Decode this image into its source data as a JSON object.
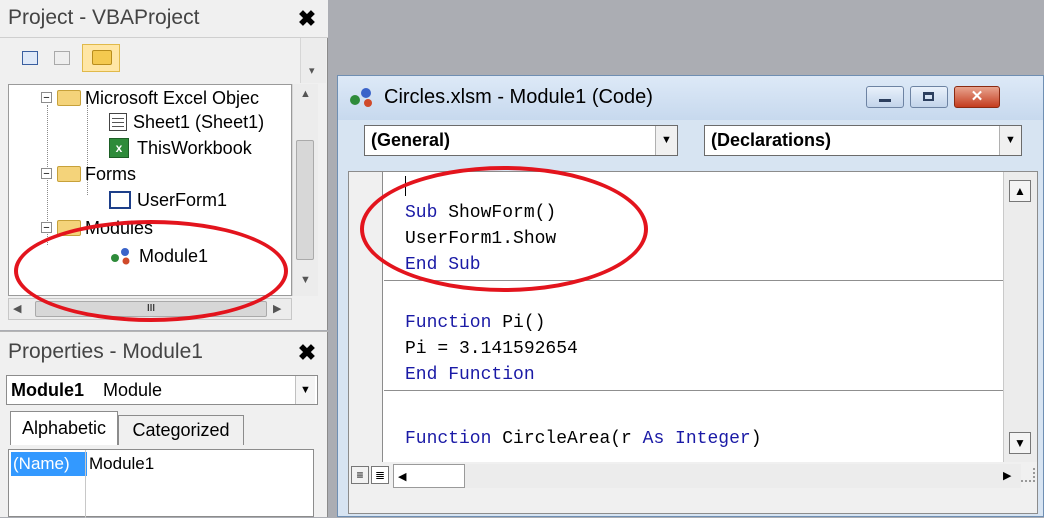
{
  "project_panel": {
    "title": "Project - VBAProject",
    "close_glyph": "✖",
    "toolbar": {
      "view_code_icon": "view-code-icon",
      "view_object_icon": "view-object-icon",
      "toggle_folders_icon": "toggle-folders-icon"
    },
    "tree": [
      {
        "label": "Microsoft Excel Objec",
        "expander": "−",
        "icon": "folder-icon"
      },
      {
        "label": "Sheet1 (Sheet1)",
        "icon": "worksheet-icon"
      },
      {
        "label": "ThisWorkbook",
        "icon": "workbook-icon"
      },
      {
        "label": "Forms",
        "expander": "−",
        "icon": "folder-icon"
      },
      {
        "label": "UserForm1",
        "icon": "userform-icon"
      },
      {
        "label": "Modules",
        "expander": "−",
        "icon": "folder-icon"
      },
      {
        "label": "Module1",
        "icon": "module-icon"
      }
    ],
    "hscroll_grip": "III"
  },
  "properties_panel": {
    "title": "Properties - Module1",
    "close_glyph": "✖",
    "object_name": "Module1",
    "object_type": "Module",
    "tabs": [
      {
        "label": "Alphabetic",
        "active": true
      },
      {
        "label": "Categorized",
        "active": false
      }
    ],
    "rows": [
      {
        "name": "(Name)",
        "value": "Module1",
        "selected": true
      }
    ]
  },
  "code_window": {
    "title": "Circles.xlsm - Module1 (Code)",
    "object_dropdown": "(General)",
    "procedure_dropdown": "(Declarations)",
    "close_glyph": "✕",
    "procedures": [
      {
        "lines": [
          [
            "Sub",
            " ShowForm()"
          ],
          [
            "",
            "UserForm1.Show"
          ],
          [
            "End Sub",
            ""
          ]
        ]
      },
      {
        "lines": [
          [
            "Function",
            " Pi()"
          ],
          [
            "",
            "Pi = 3.141592654"
          ],
          [
            "End Function",
            ""
          ]
        ]
      },
      {
        "lines": [
          [
            "Function",
            " CircleArea(r ",
            "As Integer",
            ")"
          ]
        ]
      }
    ]
  },
  "colors": {
    "annotation": "#e3141d",
    "keyword": "#1a1aa6",
    "selection": "#3399ff"
  }
}
